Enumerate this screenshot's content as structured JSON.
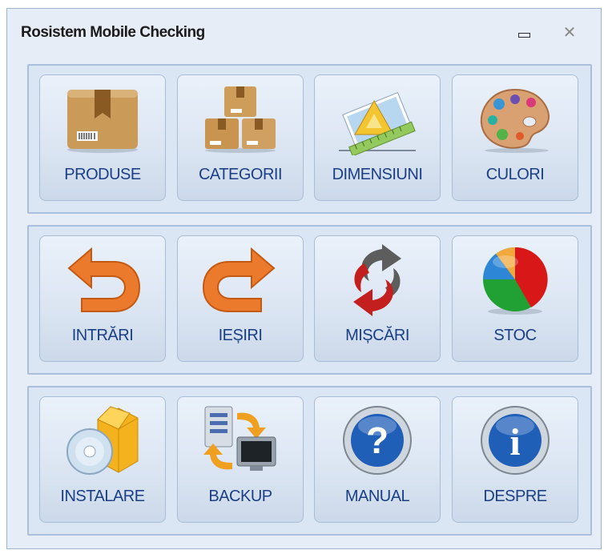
{
  "window": {
    "title": "Rosistem Mobile Checking",
    "minimize_glyph": "▭",
    "close_glyph": "✕"
  },
  "groups": [
    {
      "buttons": [
        {
          "label": "PRODUSE",
          "icon": "package-box-icon"
        },
        {
          "label": "CATEGORII",
          "icon": "stacked-boxes-icon"
        },
        {
          "label": "DIMENSIUNI",
          "icon": "triangle-ruler-icon"
        },
        {
          "label": "CULORI",
          "icon": "paint-palette-icon"
        }
      ]
    },
    {
      "buttons": [
        {
          "label": "INTRĂRI",
          "icon": "undo-arrow-icon"
        },
        {
          "label": "IEȘIRI",
          "icon": "redo-arrow-icon"
        },
        {
          "label": "MIȘCĂRI",
          "icon": "sync-arrows-icon"
        },
        {
          "label": "STOC",
          "icon": "pie-chart-icon"
        }
      ]
    },
    {
      "buttons": [
        {
          "label": "INSTALARE",
          "icon": "install-cd-box-icon"
        },
        {
          "label": "BACKUP",
          "icon": "backup-transfer-icon"
        },
        {
          "label": "MANUAL",
          "icon": "help-question-icon"
        },
        {
          "label": "DESPRE",
          "icon": "info-icon"
        }
      ]
    }
  ],
  "colors": {
    "window_bg": "#e6edf7",
    "group_border": "#a9bfdc",
    "label_text": "#1b3f85",
    "arrow_orange": "#ec7a2c",
    "sync_red": "#c41f1f",
    "help_blue": "#1f5fb8"
  }
}
